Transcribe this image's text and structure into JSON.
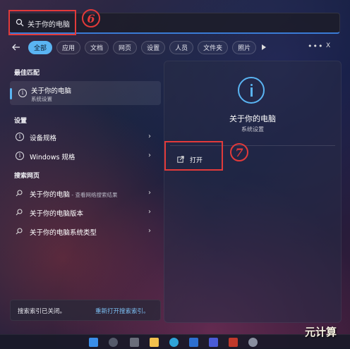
{
  "search": {
    "query": "关于你的电脑"
  },
  "annotations": {
    "step6": "6",
    "step7": "7"
  },
  "filters": {
    "chips": [
      "全部",
      "应用",
      "文档",
      "网页",
      "设置",
      "人员",
      "文件夹",
      "照片"
    ],
    "more": "•••",
    "close": "X"
  },
  "best_match": {
    "heading": "最佳匹配",
    "title": "关于你的电脑",
    "subtitle": "系统设置"
  },
  "settings": {
    "heading": "设置",
    "items": [
      "设备规格",
      "Windows 规格"
    ]
  },
  "web": {
    "heading": "搜索网页",
    "items": [
      {
        "title": "关于你的电脑",
        "suffix": " - 查看网络搜索结果"
      },
      {
        "title": "关于你的电脑版本",
        "suffix": ""
      },
      {
        "title": "关于你的电脑系统类型",
        "suffix": ""
      }
    ]
  },
  "index_bar": {
    "text": "搜索索引已关闭。",
    "link": "重新打开搜索索引。"
  },
  "preview": {
    "title": "关于你的电脑",
    "subtitle": "系统设置",
    "open_label": "打开"
  },
  "watermark": "元计算",
  "colors": {
    "accent": "#5ab4f2",
    "annotation": "#e23a3a"
  }
}
